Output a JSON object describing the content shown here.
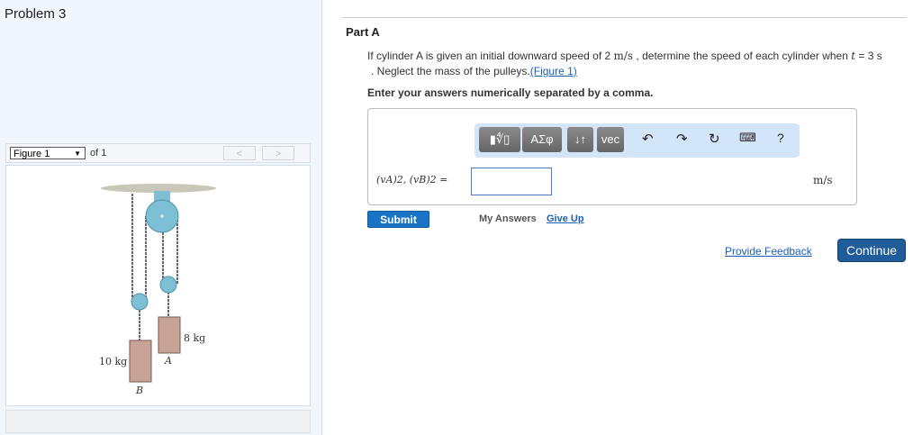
{
  "problem_title": "Problem 3",
  "figure": {
    "selector": "Figure 1",
    "of": "of 1",
    "prev": "<",
    "next": ">",
    "labels": {
      "mass_a": "8 kg",
      "mass_b": "10 kg",
      "a": "A",
      "b": "B"
    }
  },
  "part": {
    "title": "Part A",
    "q1": "If cylinder A is given an initial downward speed of 2 ",
    "q_unit": "m/s",
    "q2": " , determine the speed of each cylinder when ",
    "q_t": "t",
    "q3": " = 3 s",
    "q4": ". Neglect the mass of the pulleys.",
    "fig_link": "(Figure 1)",
    "instruction": "Enter your answers numerically separated by a comma."
  },
  "toolbar": {
    "templates": "▮∜▯",
    "greek": "ΑΣφ",
    "arrows": "↓↑",
    "vec": "vec",
    "help": "?"
  },
  "answer": {
    "label": "(vA)2, (vB)2 =",
    "value": "",
    "unit": "m/s"
  },
  "actions": {
    "submit": "Submit",
    "my_answers": "My Answers",
    "give_up": "Give Up",
    "feedback": "Provide Feedback",
    "continue": "Continue"
  }
}
